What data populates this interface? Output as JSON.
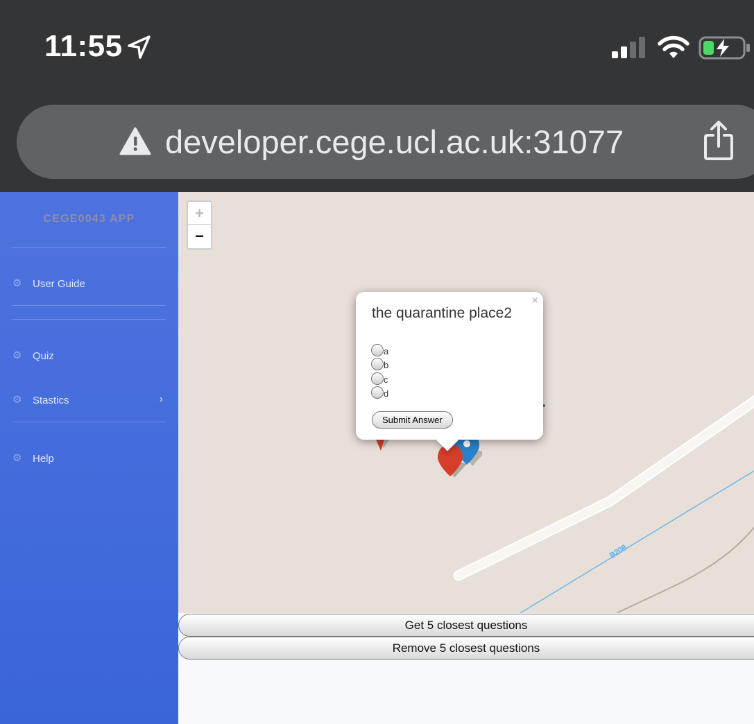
{
  "status_bar": {
    "time": "11:55"
  },
  "browser": {
    "url": "developer.cege.ucl.ac.uk:31077"
  },
  "sidebar": {
    "brand": "CEGE0043 APP",
    "items": [
      {
        "label": "User Guide",
        "icon": "gear-icon"
      },
      {
        "label": "Quiz",
        "icon": "gear-icon"
      },
      {
        "label": "Stastics",
        "icon": "gear-icon",
        "has_submenu": true
      },
      {
        "label": "Help",
        "icon": "gear-icon"
      }
    ]
  },
  "map": {
    "zoom_in": "+",
    "zoom_out": "−",
    "popup": {
      "close": "×",
      "question": "the quarantine place2",
      "options": [
        "a",
        "b",
        "c",
        "d"
      ],
      "submit_label": "Submit Answer"
    },
    "road_label": "B208"
  },
  "actions": {
    "get_closest": "Get 5 closest questions",
    "remove_closest": "Remove 5 closest questions"
  },
  "colors": {
    "sidebar": "#4e73df",
    "marker_red": "#d63e2a",
    "marker_blue": "#2a81cb",
    "map_bg": "#e8e0d8"
  }
}
